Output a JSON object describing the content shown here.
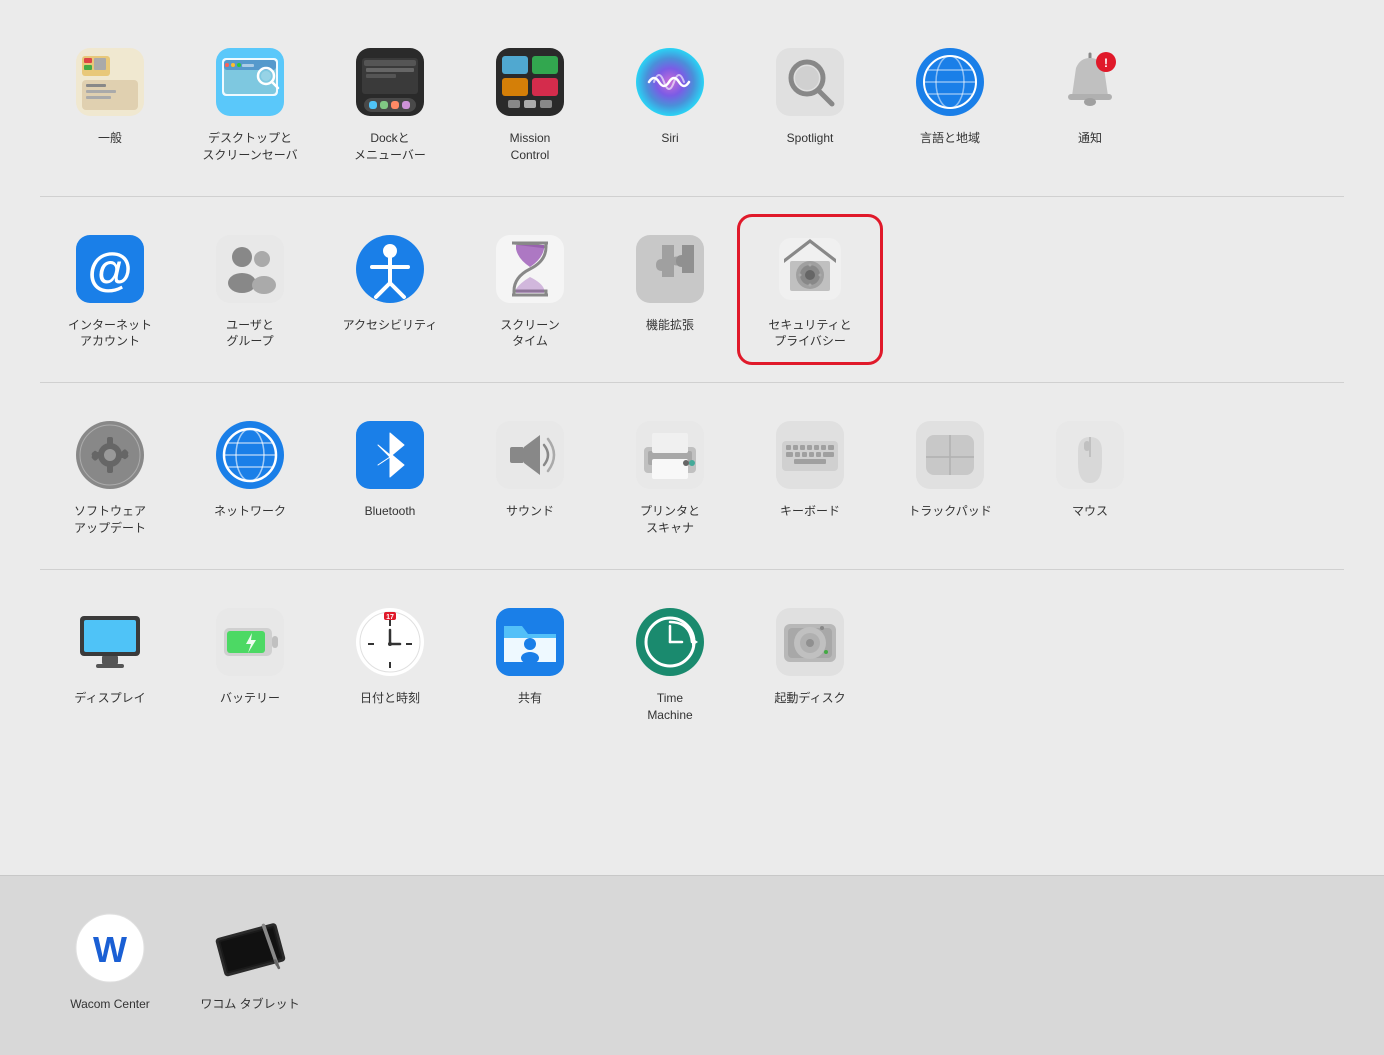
{
  "sections": [
    {
      "id": "section1",
      "items": [
        {
          "id": "general",
          "label": "一般",
          "iconType": "general"
        },
        {
          "id": "desktop",
          "label": "デスクトップと\nスクリーンセーバ",
          "iconType": "desktop"
        },
        {
          "id": "dock",
          "label": "Dockと\nメニューバー",
          "iconType": "dock"
        },
        {
          "id": "mission",
          "label": "Mission\nControl",
          "iconType": "mission"
        },
        {
          "id": "siri",
          "label": "Siri",
          "iconType": "siri"
        },
        {
          "id": "spotlight",
          "label": "Spotlight",
          "iconType": "spotlight"
        },
        {
          "id": "language",
          "label": "言語と地域",
          "iconType": "language"
        },
        {
          "id": "notification",
          "label": "通知",
          "iconType": "notification"
        }
      ]
    },
    {
      "id": "section2",
      "items": [
        {
          "id": "internet",
          "label": "インターネット\nアカウント",
          "iconType": "internet"
        },
        {
          "id": "users",
          "label": "ユーザと\nグループ",
          "iconType": "users"
        },
        {
          "id": "accessibility",
          "label": "アクセシビリティ",
          "iconType": "accessibility"
        },
        {
          "id": "screentime",
          "label": "スクリーン\nタイム",
          "iconType": "screentime"
        },
        {
          "id": "extensions",
          "label": "機能拡張",
          "iconType": "extensions"
        },
        {
          "id": "security",
          "label": "セキュリティと\nプライバシー",
          "iconType": "security",
          "selected": true
        }
      ]
    },
    {
      "id": "section3",
      "items": [
        {
          "id": "software",
          "label": "ソフトウェア\nアップデート",
          "iconType": "software"
        },
        {
          "id": "network",
          "label": "ネットワーク",
          "iconType": "network"
        },
        {
          "id": "bluetooth",
          "label": "Bluetooth",
          "iconType": "bluetooth"
        },
        {
          "id": "sound",
          "label": "サウンド",
          "iconType": "sound"
        },
        {
          "id": "printer",
          "label": "プリンタと\nスキャナ",
          "iconType": "printer"
        },
        {
          "id": "keyboard",
          "label": "キーボード",
          "iconType": "keyboard"
        },
        {
          "id": "trackpad",
          "label": "トラックパッド",
          "iconType": "trackpad"
        },
        {
          "id": "mouse",
          "label": "マウス",
          "iconType": "mouse"
        }
      ]
    },
    {
      "id": "section4",
      "items": [
        {
          "id": "display",
          "label": "ディスプレイ",
          "iconType": "display"
        },
        {
          "id": "battery",
          "label": "バッテリー",
          "iconType": "battery"
        },
        {
          "id": "datetime",
          "label": "日付と時刻",
          "iconType": "datetime"
        },
        {
          "id": "sharing",
          "label": "共有",
          "iconType": "sharing"
        },
        {
          "id": "timemachine",
          "label": "Time\nMachine",
          "iconType": "timemachine"
        },
        {
          "id": "startup",
          "label": "起動ディスク",
          "iconType": "startup"
        }
      ]
    }
  ],
  "bottomSection": {
    "items": [
      {
        "id": "wacom-center",
        "label": "Wacom Center",
        "iconType": "wacomcenter"
      },
      {
        "id": "wacom-tablet",
        "label": "ワコム タブレット",
        "iconType": "wacomtablet"
      }
    ]
  }
}
